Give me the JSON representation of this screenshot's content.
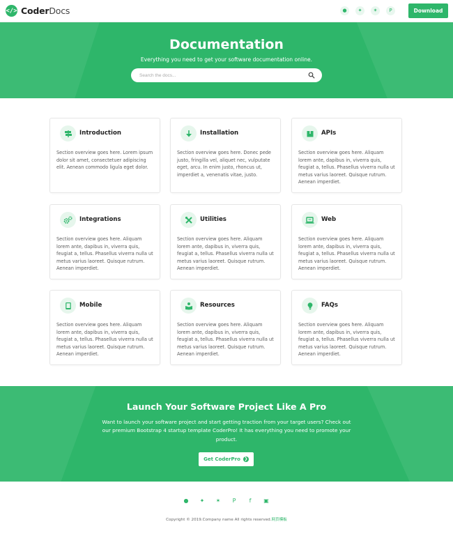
{
  "brand": {
    "code": "</>",
    "name_bold": "Coder",
    "name_thin": "Docs"
  },
  "nav": {
    "social_icons": [
      "github-icon",
      "twitter-icon",
      "slack-icon",
      "product-hunt-icon"
    ],
    "social_glyphs": [
      "●",
      "✦",
      "✶",
      "P"
    ],
    "download_label": "Download"
  },
  "hero": {
    "title": "Documentation",
    "subtitle": "Everything you need to get your software documentation online.",
    "search_placeholder": "Search the docs..."
  },
  "cards": [
    {
      "title": "Introduction",
      "icon": "map-signs-icon",
      "text": "Section overview goes here. Lorem ipsum dolor sit amet, consectetuer adipiscing elit. Aenean commodo ligula eget dolor."
    },
    {
      "title": "Installation",
      "icon": "arrow-down-icon",
      "text": "Section overview goes here. Donec pede justo, fringilla vel, aliquet nec, vulputate eget, arcu. In enim justo, rhoncus ut, imperdiet a, venenatis vitae, justo."
    },
    {
      "title": "APIs",
      "icon": "box-icon",
      "text": "Section overview goes here. Aliquam lorem ante, dapibus in, viverra quis, feugiat a, tellus. Phasellus viverra nulla ut metus varius laoreet. Quisque rutrum. Aenean imperdiet."
    },
    {
      "title": "Integrations",
      "icon": "cogs-icon",
      "text": "Section overview goes here. Aliquam lorem ante, dapibus in, viverra quis, feugiat a, tellus. Phasellus viverra nulla ut metus varius laoreet. Quisque rutrum. Aenean imperdiet."
    },
    {
      "title": "Utilities",
      "icon": "tools-icon",
      "text": "Section overview goes here. Aliquam lorem ante, dapibus in, viverra quis, feugiat a, tellus. Phasellus viverra nulla ut metus varius laoreet. Quisque rutrum. Aenean imperdiet."
    },
    {
      "title": "Web",
      "icon": "laptop-code-icon",
      "text": "Section overview goes here. Aliquam lorem ante, dapibus in, viverra quis, feugiat a, tellus. Phasellus viverra nulla ut metus varius laoreet. Quisque rutrum. Aenean imperdiet."
    },
    {
      "title": "Mobile",
      "icon": "tablet-icon",
      "text": "Section overview goes here. Aliquam lorem ante, dapibus in, viverra quis, feugiat a, tellus. Phasellus viverra nulla ut metus varius laoreet. Quisque rutrum. Aenean imperdiet."
    },
    {
      "title": "Resources",
      "icon": "book-reader-icon",
      "text": "Section overview goes here. Aliquam lorem ante, dapibus in, viverra quis, feugiat a, tellus. Phasellus viverra nulla ut metus varius laoreet. Quisque rutrum. Aenean imperdiet."
    },
    {
      "title": "FAQs",
      "icon": "lightbulb-icon",
      "text": "Section overview goes here. Aliquam lorem ante, dapibus in, viverra quis, feugiat a, tellus. Phasellus viverra nulla ut metus varius laoreet. Quisque rutrum. Aenean imperdiet."
    }
  ],
  "cta": {
    "title": "Launch Your Software Project Like A Pro",
    "text": "Want to launch your software project and start getting traction from your target users? Check out our premium Bootstrap 4 startup template CoderPro! It has everything you need to promote your product.",
    "button_label": "Get CoderPro",
    "button_arrow": "❯"
  },
  "footer": {
    "social_icons": [
      "github-icon",
      "twitter-icon",
      "slack-icon",
      "product-hunt-icon",
      "facebook-icon",
      "instagram-icon"
    ],
    "social_glyphs": [
      "●",
      "✦",
      "✶",
      "P",
      "f",
      "▣"
    ],
    "copyright": "Copyright © 2019.Company name All rights reserved.",
    "made_by": "网页模板"
  },
  "colors": {
    "brand_green": "#2eb66a",
    "light_green": "#e6f6ec"
  }
}
